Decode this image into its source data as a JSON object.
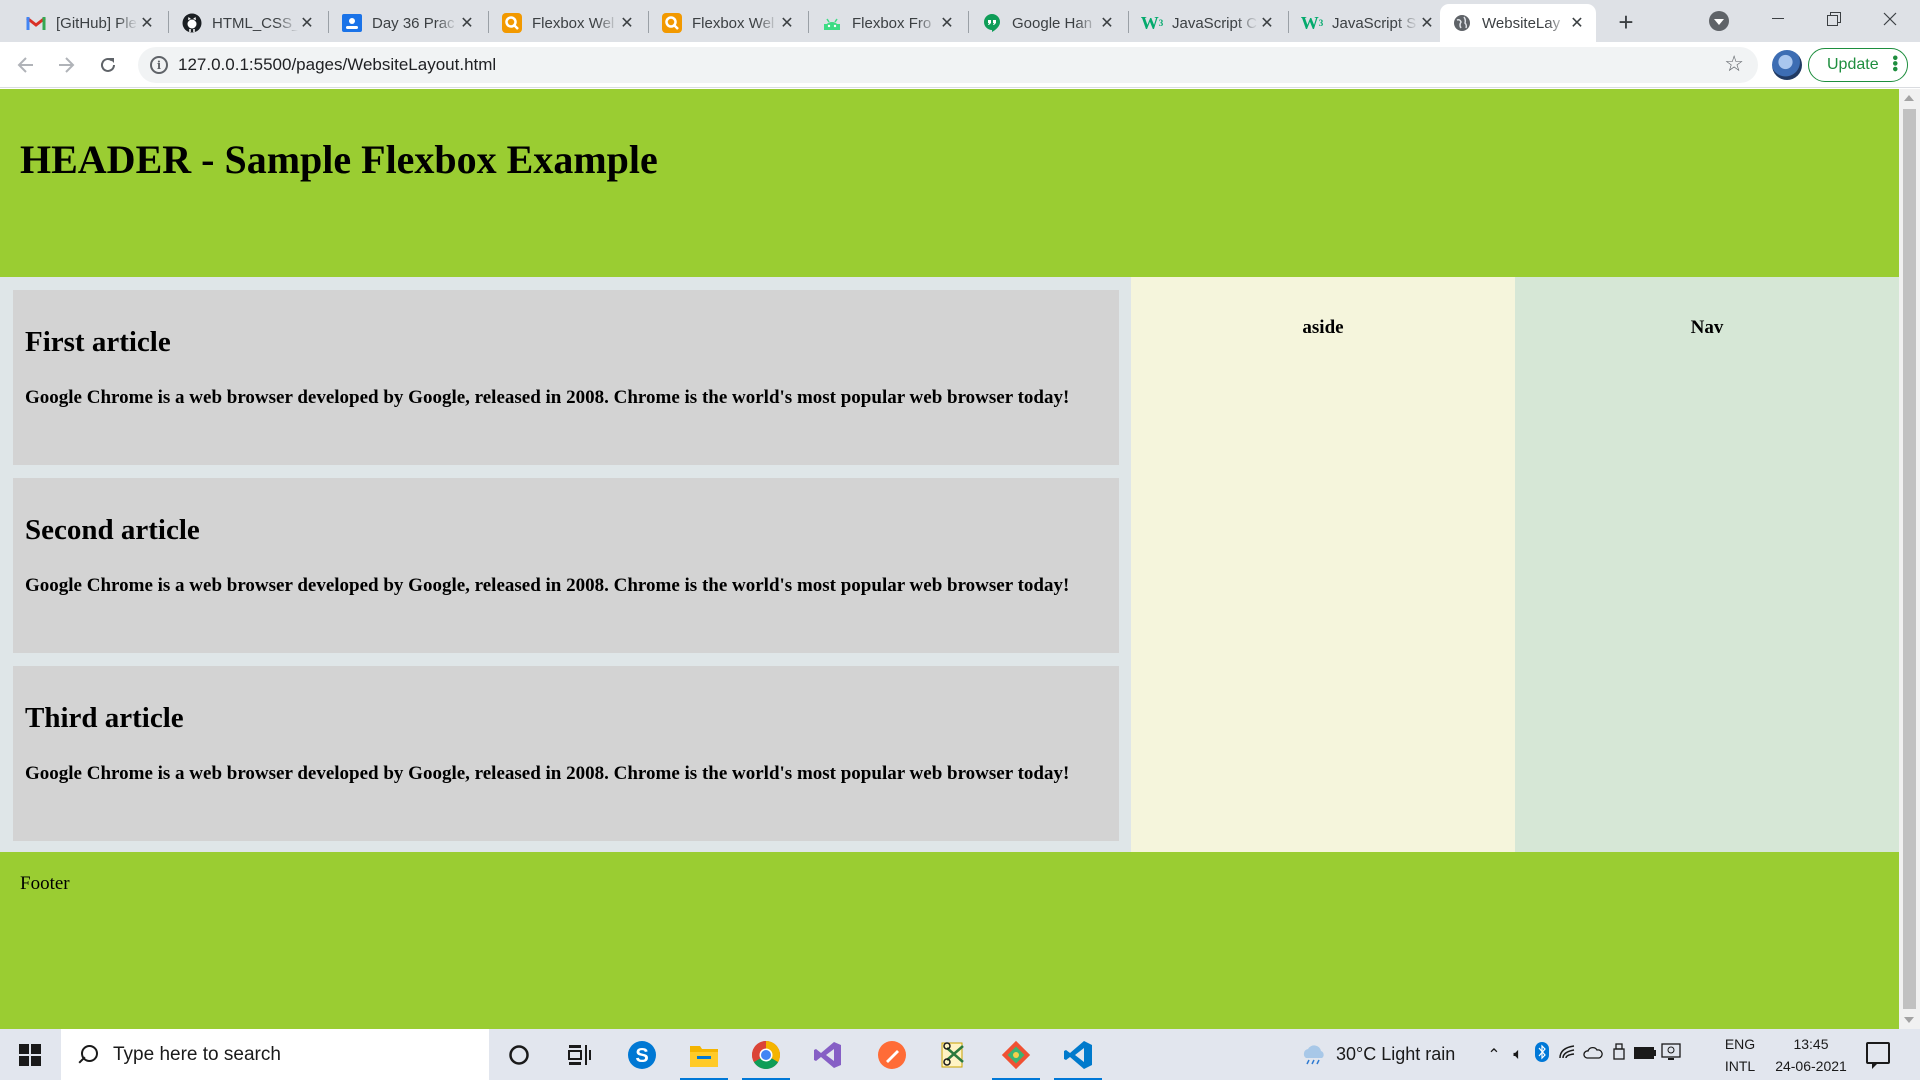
{
  "browser": {
    "tabs": [
      {
        "title": "[GitHub] Ple",
        "favicon": "gmail-icon",
        "color": "#d93025",
        "active": false
      },
      {
        "title": "HTML_CSS_",
        "favicon": "github-icon",
        "color": "#1b1f23",
        "active": false
      },
      {
        "title": "Day 36 Prac",
        "favicon": "google-classroom-icon",
        "color": "#1a73e8",
        "active": false
      },
      {
        "title": "Flexbox Wel",
        "favicon": "search-magnifier-icon",
        "color": "#f29900",
        "active": false
      },
      {
        "title": "Flexbox Wel",
        "favicon": "search-magnifier-icon",
        "color": "#f29900",
        "active": false
      },
      {
        "title": "Flexbox Fro",
        "favicon": "android-icon",
        "color": "#3ddc84",
        "active": false
      },
      {
        "title": "Google Han",
        "favicon": "google-hangouts-icon",
        "color": "#0f9d58",
        "active": false
      },
      {
        "title": "JavaScript C",
        "favicon": "w3schools-icon",
        "color": "#04aa6d",
        "active": false
      },
      {
        "title": "JavaScript S",
        "favicon": "w3schools-icon",
        "color": "#04aa6d",
        "active": false
      },
      {
        "title": "WebsiteLay",
        "favicon": "globe-icon",
        "color": "#5f6368",
        "active": true
      }
    ],
    "url": "127.0.0.1:5500/pages/WebsiteLayout.html",
    "update_label": "Update"
  },
  "page": {
    "header_title": "HEADER - Sample Flexbox Example",
    "articles": [
      {
        "heading": "First article",
        "body": "Google Chrome is a web browser developed by Google, released in 2008. Chrome is the world's most popular web browser today!"
      },
      {
        "heading": "Second article",
        "body": "Google Chrome is a web browser developed by Google, released in 2008. Chrome is the world's most popular web browser today!"
      },
      {
        "heading": "Third article",
        "body": "Google Chrome is a web browser developed by Google, released in 2008. Chrome is the world's most popular web browser today!"
      }
    ],
    "aside_label": "aside",
    "nav_label": "Nav",
    "footer_text": "Footer",
    "colors": {
      "header_bg": "#9acd32",
      "article_bg": "#d3d3d3",
      "aside_bg": "#f5f5dc",
      "nav_bg": "#d6e7d6"
    }
  },
  "taskbar": {
    "search_placeholder": "Type here to search",
    "apps": [
      "cortana-icon",
      "task-view-icon",
      "skype-icon",
      "file-explorer-icon",
      "chrome-icon",
      "visual-studio-icon",
      "postman-icon",
      "snipping-tool-icon",
      "git-icon",
      "vscode-icon"
    ],
    "weather": "30°C  Light rain",
    "language_line1": "ENG",
    "language_line2": "INTL",
    "time": "13:45",
    "date": "24-06-2021"
  }
}
